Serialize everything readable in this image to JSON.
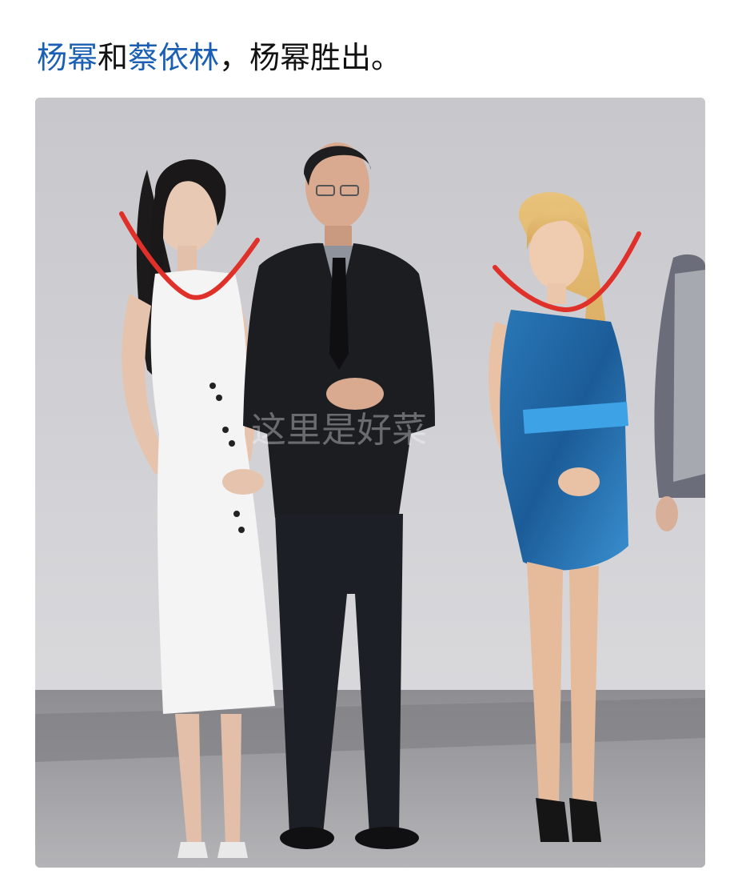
{
  "post": {
    "segments": [
      {
        "text": "杨幂",
        "type": "link"
      },
      {
        "text": "和",
        "type": "text"
      },
      {
        "text": "蔡依林",
        "type": "link"
      },
      {
        "text": "，杨幂胜出。",
        "type": "text"
      }
    ]
  },
  "photo": {
    "watermark": "这里是好菜"
  },
  "colors": {
    "link": "#1a5fb4",
    "text": "#111111",
    "annotation": "#e0302a"
  }
}
